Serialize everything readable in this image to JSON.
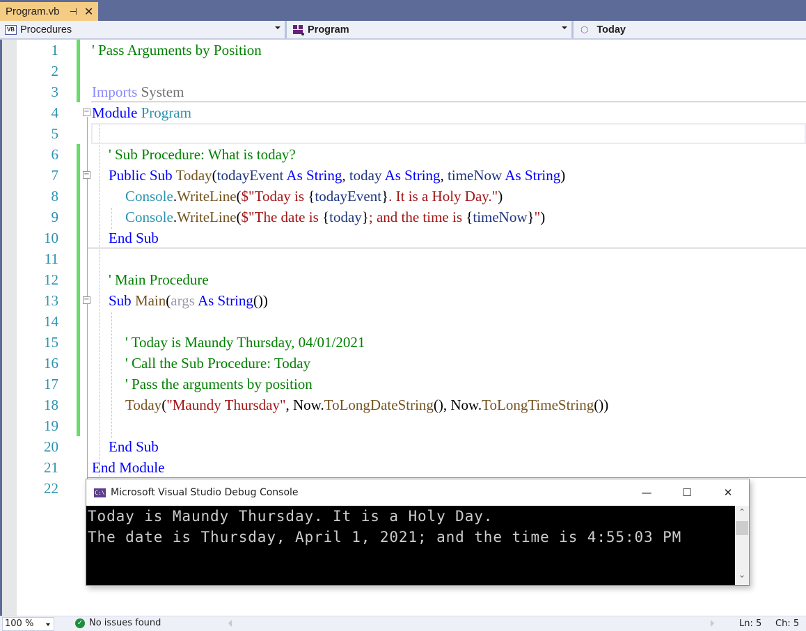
{
  "tab": {
    "title": "Program.vb",
    "pin_icon": "pin-icon",
    "close_icon": "close-icon"
  },
  "navbar": {
    "project_dropdown": {
      "icon": "vb-project-icon",
      "badge": "VB",
      "value": "Procedures"
    },
    "type_dropdown": {
      "icon": "module-icon",
      "value": "Program"
    },
    "member_dropdown": {
      "icon": "method-cube-icon",
      "value": "Today"
    }
  },
  "editor": {
    "line_numbers": [
      "1",
      "2",
      "3",
      "4",
      "5",
      "6",
      "7",
      "8",
      "9",
      "10",
      "11",
      "12",
      "13",
      "14",
      "15",
      "16",
      "17",
      "18",
      "19",
      "20",
      "21",
      "22"
    ],
    "lines": [
      {
        "n": 1,
        "tokens": [
          {
            "t": "' Pass Arguments by Position",
            "c": "cm"
          }
        ]
      },
      {
        "n": 2,
        "tokens": []
      },
      {
        "n": 3,
        "tokens": [
          {
            "t": "Imports",
            "c": "im"
          },
          {
            "t": " System",
            "c": "ns"
          }
        ]
      },
      {
        "n": 4,
        "tokens": [
          {
            "t": "Module",
            "c": "kw"
          },
          {
            "t": " ",
            "c": ""
          },
          {
            "t": "Program",
            "c": "ty"
          }
        ]
      },
      {
        "n": 5,
        "tokens": []
      },
      {
        "n": 6,
        "tokens": [
          {
            "t": "' Sub Procedure: What is today?",
            "c": "cm"
          }
        ]
      },
      {
        "n": 7,
        "tokens": [
          {
            "t": "Public Sub",
            "c": "kw"
          },
          {
            "t": " ",
            "c": ""
          },
          {
            "t": "Today",
            "c": "fn"
          },
          {
            "t": "(",
            "c": ""
          },
          {
            "t": "todayEvent",
            "c": "pa"
          },
          {
            "t": " ",
            "c": ""
          },
          {
            "t": "As String",
            "c": "kw"
          },
          {
            "t": ", ",
            "c": ""
          },
          {
            "t": "today",
            "c": "pa"
          },
          {
            "t": " ",
            "c": ""
          },
          {
            "t": "As String",
            "c": "kw"
          },
          {
            "t": ", ",
            "c": ""
          },
          {
            "t": "timeNow",
            "c": "pa"
          },
          {
            "t": " ",
            "c": ""
          },
          {
            "t": "As String",
            "c": "kw"
          },
          {
            "t": ")",
            "c": ""
          }
        ]
      },
      {
        "n": 8,
        "tokens": [
          {
            "t": "Console",
            "c": "ty"
          },
          {
            "t": ".",
            "c": ""
          },
          {
            "t": "WriteLine",
            "c": "fn"
          },
          {
            "t": "(",
            "c": ""
          },
          {
            "t": "$\"Today is ",
            "c": "st"
          },
          {
            "t": "{",
            "c": ""
          },
          {
            "t": "todayEvent",
            "c": "pa"
          },
          {
            "t": "}",
            "c": ""
          },
          {
            "t": ". It is a Holy Day.\"",
            "c": "st"
          },
          {
            "t": ")",
            "c": ""
          }
        ]
      },
      {
        "n": 9,
        "tokens": [
          {
            "t": "Console",
            "c": "ty"
          },
          {
            "t": ".",
            "c": ""
          },
          {
            "t": "WriteLine",
            "c": "fn"
          },
          {
            "t": "(",
            "c": ""
          },
          {
            "t": "$\"The date is ",
            "c": "st"
          },
          {
            "t": "{",
            "c": ""
          },
          {
            "t": "today",
            "c": "pa"
          },
          {
            "t": "}",
            "c": ""
          },
          {
            "t": "; and the time is ",
            "c": "st"
          },
          {
            "t": "{",
            "c": ""
          },
          {
            "t": "timeNow",
            "c": "pa"
          },
          {
            "t": "}",
            "c": ""
          },
          {
            "t": "\"",
            "c": "st"
          },
          {
            "t": ")",
            "c": ""
          }
        ]
      },
      {
        "n": 10,
        "tokens": [
          {
            "t": "End Sub",
            "c": "kw"
          }
        ]
      },
      {
        "n": 11,
        "tokens": []
      },
      {
        "n": 12,
        "tokens": [
          {
            "t": "' Main Procedure",
            "c": "cm"
          }
        ]
      },
      {
        "n": 13,
        "tokens": [
          {
            "t": "Sub",
            "c": "kw"
          },
          {
            "t": " ",
            "c": ""
          },
          {
            "t": "Main",
            "c": "fn"
          },
          {
            "t": "(",
            "c": ""
          },
          {
            "t": "args",
            "c": "un"
          },
          {
            "t": " ",
            "c": ""
          },
          {
            "t": "As String",
            "c": "kw"
          },
          {
            "t": "())",
            "c": ""
          }
        ]
      },
      {
        "n": 14,
        "tokens": []
      },
      {
        "n": 15,
        "tokens": [
          {
            "t": "' Today is Maundy Thursday, 04/01/2021",
            "c": "cm"
          }
        ]
      },
      {
        "n": 16,
        "tokens": [
          {
            "t": "' Call the Sub Procedure: Today",
            "c": "cm"
          }
        ]
      },
      {
        "n": 17,
        "tokens": [
          {
            "t": "' Pass the arguments by position",
            "c": "cm"
          }
        ]
      },
      {
        "n": 18,
        "tokens": [
          {
            "t": "Today",
            "c": "fn"
          },
          {
            "t": "(",
            "c": ""
          },
          {
            "t": "\"Maundy Thursday\"",
            "c": "st"
          },
          {
            "t": ", Now.",
            "c": ""
          },
          {
            "t": "ToLongDateString",
            "c": "fn"
          },
          {
            "t": "(), Now.",
            "c": ""
          },
          {
            "t": "ToLongTimeString",
            "c": "fn"
          },
          {
            "t": "())",
            "c": ""
          }
        ]
      },
      {
        "n": 19,
        "tokens": []
      },
      {
        "n": 20,
        "tokens": [
          {
            "t": "End Sub",
            "c": "kw"
          }
        ]
      },
      {
        "n": 21,
        "tokens": [
          {
            "t": "End Module",
            "c": "kw"
          }
        ]
      },
      {
        "n": 22,
        "tokens": []
      }
    ]
  },
  "console": {
    "title": "Microsoft Visual Studio Debug Console",
    "icon_label": "C:\\",
    "minimize": "—",
    "maximize": "☐",
    "close": "✕",
    "output": [
      "Today is Maundy Thursday. It is a Holy Day.",
      "The date is Thursday, April 1, 2021; and the time is 4:55:03 PM"
    ]
  },
  "status": {
    "zoom": "100 %",
    "issues": "No issues found",
    "line": "Ln: 5",
    "char": "Ch: 5"
  },
  "colors": {
    "tab_active": "#f5cc84",
    "chrome": "#5d6b99",
    "keyword": "#0000ff",
    "comment": "#008000",
    "type": "#2b91af",
    "string": "#a31515",
    "method": "#74531f",
    "parameter": "#1f377f",
    "change_marker": "#6bdc6b"
  }
}
